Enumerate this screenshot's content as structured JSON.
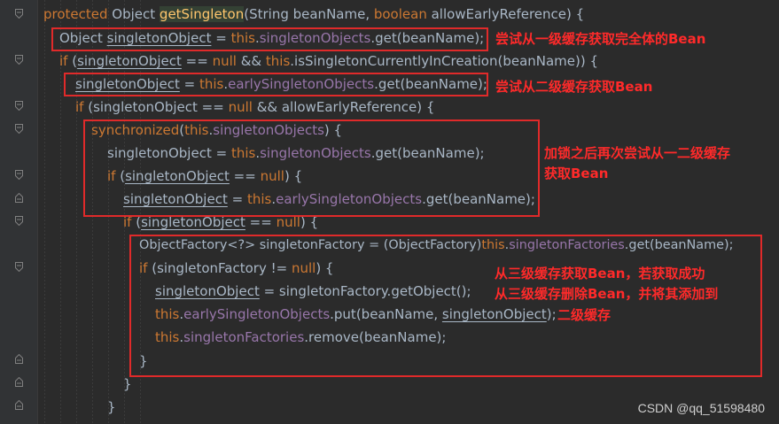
{
  "code": {
    "l1": {
      "a": "protected ",
      "b": "Object ",
      "c": "getSingleton",
      "d": "(String beanName, ",
      "e": "boolean ",
      "f": "allowEarlyReference) {"
    },
    "l2": {
      "a": "Object ",
      "b": "singletonObject",
      "c": " = ",
      "d": "this",
      "e": ".",
      "f": "singletonObjects",
      "g": ".get(beanName);"
    },
    "l3": {
      "a": "if ",
      "b": "(",
      "c": "singletonObject",
      "d": " == ",
      "e": "null ",
      "f": "&& ",
      "g": "this",
      "h": ".isSingletonCurrentlyInCreation(beanName)) {"
    },
    "l4": {
      "a": "singletonObject",
      "b": " = ",
      "c": "this",
      "d": ".",
      "e": "earlySingletonObjects",
      "f": ".get(beanName);"
    },
    "l5": {
      "a": "if ",
      "b": "(singletonObject == ",
      "c": "null ",
      "d": "&& allowEarlyReference) {"
    },
    "l6": {
      "a": "synchronized",
      "b": "(",
      "c": "this",
      "d": ".",
      "e": "singletonObjects",
      "f": ") {"
    },
    "l7": {
      "a": "singletonObject = ",
      "b": "this",
      "c": ".",
      "d": "singletonObjects",
      "e": ".get(beanName);"
    },
    "l8": {
      "a": "if ",
      "b": "(",
      "c": "singletonObject",
      "d": " == ",
      "e": "null",
      "f": ") {"
    },
    "l9": {
      "a": "singletonObject",
      "b": " = ",
      "c": "this",
      "d": ".",
      "e": "earlySingletonObjects",
      "f": ".get(beanName);"
    },
    "l10": {
      "a": "if ",
      "b": "(",
      "c": "singletonObject",
      "d": " == ",
      "e": "null",
      "f": ") {"
    },
    "l11": {
      "a": "ObjectFactory<?> singletonFactory = (ObjectFactory)",
      "b": "this",
      "c": ".",
      "d": "singletonFactories",
      "e": ".get(beanName);"
    },
    "l12": {
      "a": "if ",
      "b": "(singletonFactory != ",
      "c": "null",
      "d": ") {"
    },
    "l13": {
      "a": "singletonObject",
      "b": " = singletonFactory.getObject();"
    },
    "l14": {
      "a": "this",
      "b": ".",
      "c": "earlySingletonObjects",
      "d": ".put(beanName, ",
      "e": "singletonObject",
      "f": ");"
    },
    "l15": {
      "a": "this",
      "b": ".",
      "c": "singletonFactories",
      "d": ".remove(beanName);"
    },
    "l16": {
      "a": "}"
    },
    "l17": {
      "a": "}"
    },
    "l18": {
      "a": "}"
    }
  },
  "annotations": {
    "n1": "尝试从一级缓存获取完全体的Bean",
    "n2": "尝试从二级缓存获取Bean",
    "n3a": "加锁之后再次尝试从一二级缓存",
    "n3b": "获取Bean",
    "n4a": "从三级缓存获取Bean，若获取成功",
    "n4b": "从三级缓存删除Bean，并将其添加到",
    "n4c": "二级缓存"
  },
  "watermark": "CSDN @qq_51598480",
  "colors": {
    "keyword": "#cc7832",
    "field": "#9876aa",
    "method": "#ffc66d",
    "text": "#a9b7c6",
    "annotation": "#ff2a2a",
    "background": "#2b2b2b"
  }
}
